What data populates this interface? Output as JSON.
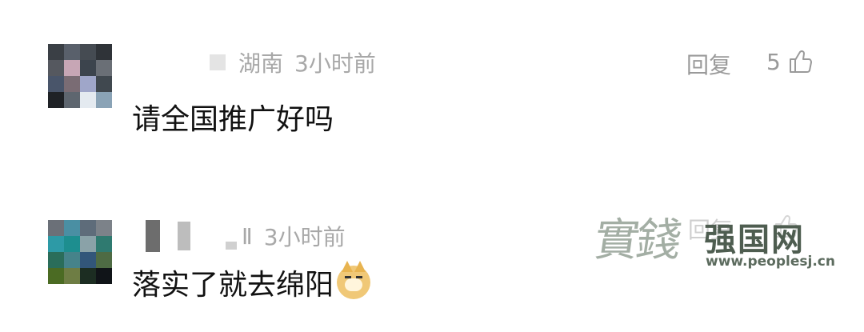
{
  "comments": [
    {
      "location": "湖南",
      "time": "3小时前",
      "text": "请全国推广好吗",
      "reply_label": "回复",
      "likes": "5",
      "avatar_colors": [
        "#3a3f45",
        "#59606b",
        "#454b52",
        "#2f3338",
        "#55585f",
        "#c7a6b5",
        "#3c444d",
        "#6a6f76",
        "#49556a",
        "#7a6c74",
        "#9fa6c9",
        "#40484f",
        "#1f2226",
        "#5e666f",
        "#e4eaf0",
        "#8aa3b6"
      ]
    },
    {
      "location_suffix": "Ⅱ",
      "time": "3小时前",
      "text": "落实了就去绵阳",
      "reply_label": "回复",
      "avatar_colors": [
        "#6b7078",
        "#4a8fa3",
        "#5e6c7a",
        "#7c8289",
        "#2d9aa6",
        "#1d8e8f",
        "#8aa2a8",
        "#2f7a70",
        "#2a6d5a",
        "#46838a",
        "#32567a",
        "#4e6b44",
        "#4b6b23",
        "#6e7d44",
        "#1c2d22",
        "#101418"
      ]
    }
  ],
  "watermark": {
    "calligraphy": "實錢",
    "title": "强国网",
    "url": "www.peoplesj.cn"
  },
  "colors": {
    "meta": "#a8a8a8",
    "text": "#111111",
    "background": "#ffffff"
  },
  "icons": {
    "like": "thumbs-up-icon",
    "emoji": "doge-emoji-icon"
  }
}
